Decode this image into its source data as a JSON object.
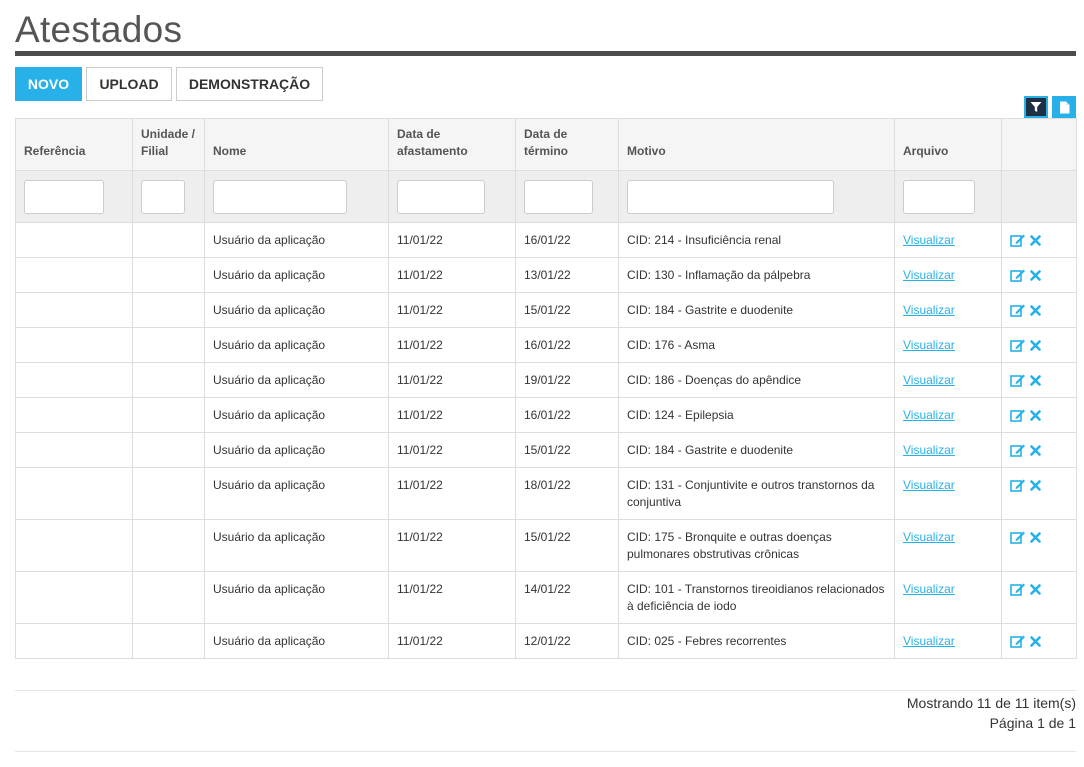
{
  "page": {
    "title": "Atestados"
  },
  "toolbar": {
    "new_label": "NOVO",
    "upload_label": "UPLOAD",
    "demo_label": "DEMONSTRAÇÃO"
  },
  "colors": {
    "accent": "#27b1e8",
    "rule": "#4d4d4d",
    "filter_bg": "#1d3142"
  },
  "icons": {
    "filter": "filter-icon",
    "export": "document-icon",
    "edit": "edit-icon",
    "delete": "delete-icon"
  },
  "table": {
    "headers": {
      "referencia": "Referência",
      "unidade_1": "Unidade /",
      "unidade_2": "Filial",
      "nome": "Nome",
      "afast_1": "Data de",
      "afast_2": "afastamento",
      "termino_1": "Data de",
      "termino_2": "término",
      "motivo": "Motivo",
      "arquivo": "Arquivo"
    },
    "link_label": "Visualizar",
    "rows": [
      {
        "referencia": "",
        "unidade": "",
        "nome": "Usuário da aplicação",
        "afastamento": "11/01/22",
        "termino": "16/01/22",
        "motivo": "CID: 214 - Insuficiência renal"
      },
      {
        "referencia": "",
        "unidade": "",
        "nome": "Usuário da aplicação",
        "afastamento": "11/01/22",
        "termino": "13/01/22",
        "motivo": "CID: 130 - Inflamação da pálpebra"
      },
      {
        "referencia": "",
        "unidade": "",
        "nome": "Usuário da aplicação",
        "afastamento": "11/01/22",
        "termino": "15/01/22",
        "motivo": "CID: 184 - Gastrite e duodenite"
      },
      {
        "referencia": "",
        "unidade": "",
        "nome": "Usuário da aplicação",
        "afastamento": "11/01/22",
        "termino": "16/01/22",
        "motivo": "CID: 176 - Asma"
      },
      {
        "referencia": "",
        "unidade": "",
        "nome": "Usuário da aplicação",
        "afastamento": "11/01/22",
        "termino": "19/01/22",
        "motivo": "CID: 186 - Doenças do apêndice"
      },
      {
        "referencia": "",
        "unidade": "",
        "nome": "Usuário da aplicação",
        "afastamento": "11/01/22",
        "termino": "16/01/22",
        "motivo": "CID: 124 - Epilepsia"
      },
      {
        "referencia": "",
        "unidade": "",
        "nome": "Usuário da aplicação",
        "afastamento": "11/01/22",
        "termino": "15/01/22",
        "motivo": "CID: 184 - Gastrite e duodenite"
      },
      {
        "referencia": "",
        "unidade": "",
        "nome": "Usuário da aplicação",
        "afastamento": "11/01/22",
        "termino": "18/01/22",
        "motivo": "CID: 131 - Conjuntivite e outros transtornos da conjuntiva"
      },
      {
        "referencia": "",
        "unidade": "",
        "nome": "Usuário da aplicação",
        "afastamento": "11/01/22",
        "termino": "15/01/22",
        "motivo": "CID: 175 - Bronquite e outras doenças pulmonares obstrutivas crônicas"
      },
      {
        "referencia": "",
        "unidade": "",
        "nome": "Usuário da aplicação",
        "afastamento": "11/01/22",
        "termino": "14/01/22",
        "motivo": "CID: 101 - Transtornos tireoidianos relacionados à deficiência de iodo"
      },
      {
        "referencia": "",
        "unidade": "",
        "nome": "Usuário da aplicação",
        "afastamento": "11/01/22",
        "termino": "12/01/22",
        "motivo": "CID: 025 - Febres recorrentes"
      }
    ]
  },
  "footer": {
    "showing": "Mostrando 11 de 11 item(s)",
    "page": "Página 1 de 1"
  }
}
